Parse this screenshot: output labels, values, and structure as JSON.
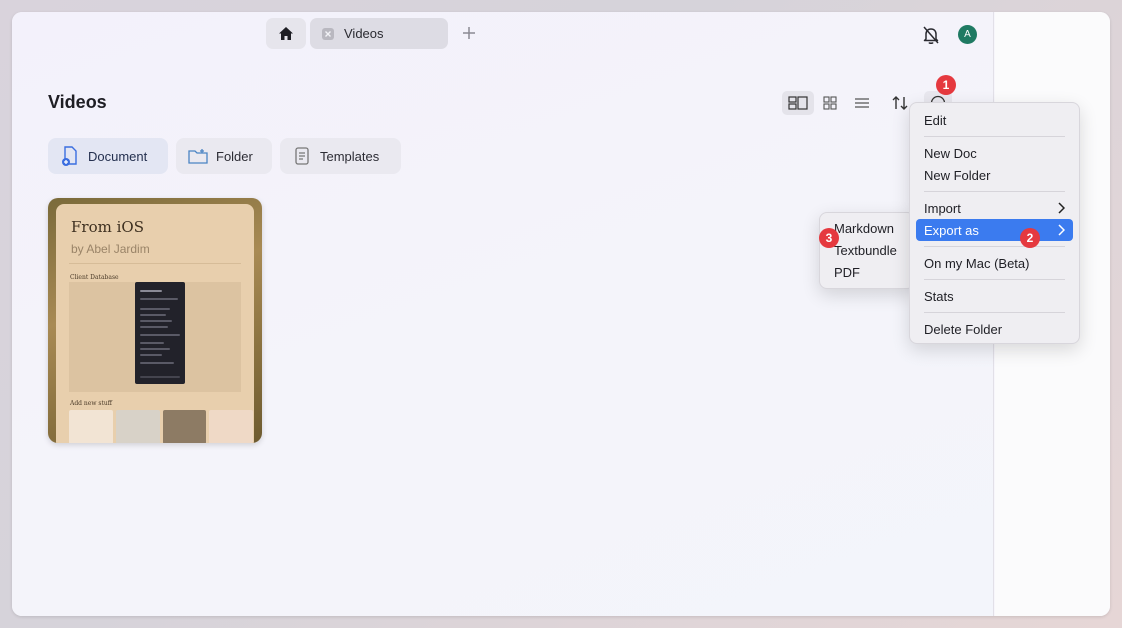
{
  "tabs": {
    "active_label": "Videos"
  },
  "user": {
    "avatar_initial": "A"
  },
  "page": {
    "title": "Videos"
  },
  "create_buttons": {
    "document": "Document",
    "folder": "Folder",
    "templates": "Templates"
  },
  "card": {
    "title": "From iOS",
    "author": "by Abel Jardim",
    "section_1": "Client Database",
    "section_2": "Add new stuff"
  },
  "menu": {
    "edit": "Edit",
    "new_doc": "New Doc",
    "new_folder": "New Folder",
    "import": "Import",
    "export_as": "Export as",
    "on_my_mac": "On my Mac (Beta)",
    "stats": "Stats",
    "delete_folder": "Delete Folder"
  },
  "export_submenu": {
    "markdown": "Markdown",
    "textbundle": "Textbundle",
    "pdf": "PDF"
  },
  "badges": {
    "step1": "1",
    "step2": "2",
    "step3": "3"
  },
  "colors": {
    "accent_highlight": "#3b7bef",
    "badge_red": "#e5393f",
    "avatar_green": "#1f7a62"
  }
}
